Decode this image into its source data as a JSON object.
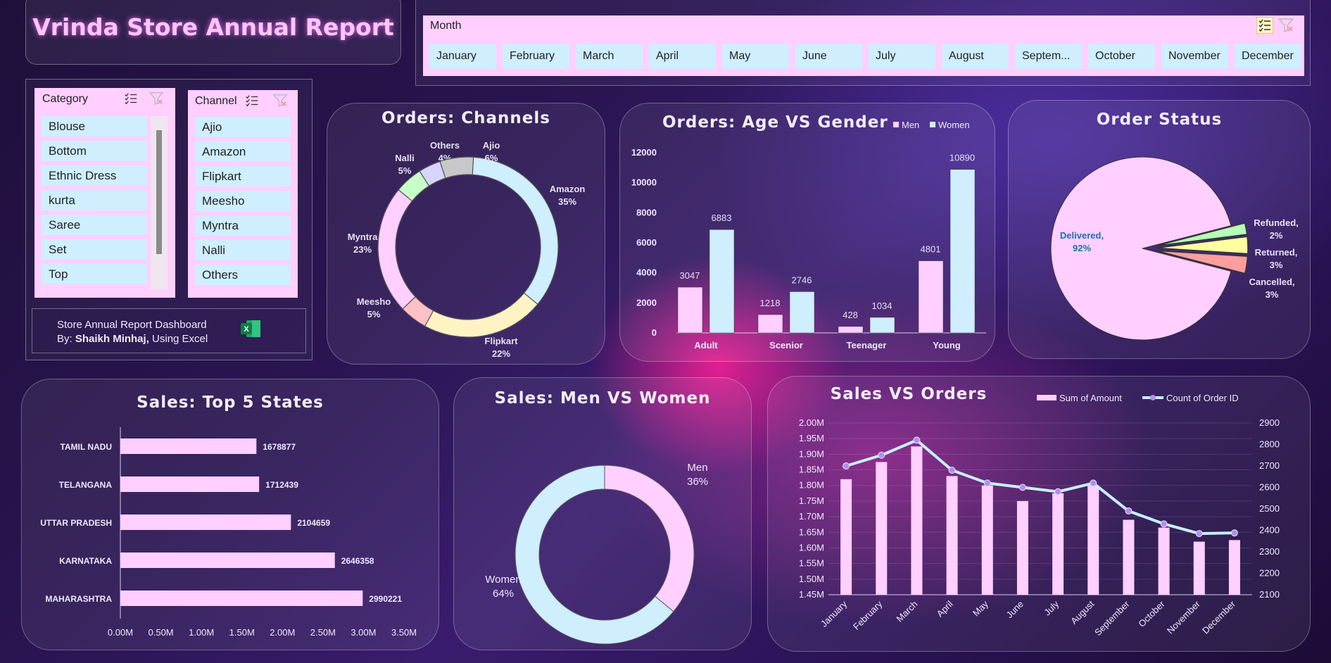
{
  "title": "Vrinda Store Annual Report",
  "month_slicer": {
    "label": "Month",
    "items": [
      "January",
      "February",
      "March",
      "April",
      "May",
      "June",
      "July",
      "August",
      "Septem...",
      "October",
      "November",
      "December"
    ]
  },
  "category_slicer": {
    "label": "Category",
    "items": [
      "Blouse",
      "Bottom",
      "Ethnic Dress",
      "kurta",
      "Saree",
      "Set",
      "Top"
    ]
  },
  "channel_slicer": {
    "label": "Channel",
    "items": [
      "Ajio",
      "Amazon",
      "Flipkart",
      "Meesho",
      "Myntra",
      "Nalli",
      "Others"
    ]
  },
  "credit": {
    "line1": "Store Annual Report Dashboard",
    "line2_prefix": "By: ",
    "line2_name": "Shaikh Minhaj,",
    "line2_suffix": " Using Excel",
    "icon": "excel-logo-icon"
  },
  "colors": {
    "pink": "#ffcfff",
    "blue": "#cfeefe",
    "yellow": "#fff3c4",
    "green": "#c8ffc8",
    "lavender": "#d8d4ff",
    "grey": "#c8c8c8",
    "peach": "#ffc0c8",
    "refunded": "#b6ffb6",
    "returned": "#ffff9e",
    "cancelled": "#ff9e9e",
    "line": "#c8f0ff",
    "marker": "#b48cf0"
  },
  "chart_data": [
    {
      "id": "channels",
      "type": "pie",
      "title": "Orders: Channels",
      "categories": [
        "Amazon",
        "Flipkart",
        "Meesho",
        "Myntra",
        "Nalli",
        "Others",
        "Ajio"
      ],
      "values": [
        35,
        22,
        5,
        23,
        5,
        4,
        6
      ],
      "labels": [
        "35%",
        "22%",
        "5%",
        "23%",
        "5%",
        "4%",
        "6%"
      ]
    },
    {
      "id": "age_gender",
      "type": "bar",
      "title": "Orders: Age VS Gender",
      "categories": [
        "Adult",
        "Scenior",
        "Teenager",
        "Young"
      ],
      "series": [
        {
          "name": "Men",
          "values": [
            3047,
            1218,
            428,
            4801
          ]
        },
        {
          "name": "Women",
          "values": [
            6883,
            2746,
            1034,
            10890
          ]
        }
      ],
      "ylim": [
        0,
        12000
      ],
      "yticks": [
        "0",
        "2000",
        "4000",
        "6000",
        "8000",
        "10000",
        "12000"
      ],
      "legend": "top-right"
    },
    {
      "id": "order_status",
      "type": "pie",
      "title": "Order Status",
      "categories": [
        "Delivered",
        "Refunded",
        "Returned",
        "Cancelled"
      ],
      "values": [
        92,
        2,
        3,
        3
      ],
      "labels": [
        "92%",
        "2%",
        "3%",
        "3%"
      ]
    },
    {
      "id": "top_states",
      "type": "bar",
      "title": "Sales: Top 5 States",
      "categories": [
        "TAMIL NADU",
        "TELANGANA",
        "UTTAR PRADESH",
        "KARNATAKA",
        "MAHARASHTRA"
      ],
      "values": [
        1678877,
        1712439,
        2104659,
        2646358,
        2990221
      ],
      "labels": [
        "1678877",
        "1712439",
        "2104659",
        "2646358",
        "2990221"
      ],
      "xlim": [
        0,
        3500000
      ],
      "xticks": [
        "0.00M",
        "0.50M",
        "1.00M",
        "1.50M",
        "2.00M",
        "2.50M",
        "3.00M",
        "3.50M"
      ]
    },
    {
      "id": "men_women",
      "type": "pie",
      "title": "Sales: Men VS Women",
      "categories": [
        "Men",
        "Women"
      ],
      "values": [
        36,
        64
      ],
      "labels": [
        "36%",
        "64%"
      ]
    },
    {
      "id": "sales_orders",
      "type": "bar",
      "title": "Sales VS Orders",
      "categories": [
        "January",
        "February",
        "March",
        "April",
        "May",
        "June",
        "July",
        "August",
        "September",
        "October",
        "November",
        "December"
      ],
      "series": [
        {
          "name": "Sum of Amount",
          "values": [
            1820000,
            1875000,
            1925000,
            1830000,
            1800000,
            1750000,
            1775000,
            1800000,
            1690000,
            1665000,
            1620000,
            1625000
          ]
        },
        {
          "name": "Count of Order ID",
          "values": [
            2700,
            2750,
            2820,
            2680,
            2620,
            2600,
            2580,
            2620,
            2490,
            2430,
            2385,
            2388
          ]
        }
      ],
      "ylim": [
        1450000,
        2000000
      ],
      "y2lim": [
        2100,
        2900
      ],
      "yticks": [
        "1.45M",
        "1.50M",
        "1.55M",
        "1.60M",
        "1.65M",
        "1.70M",
        "1.75M",
        "1.80M",
        "1.85M",
        "1.90M",
        "1.95M",
        "2.00M"
      ],
      "y2ticks": [
        "2100",
        "2200",
        "2300",
        "2400",
        "2500",
        "2600",
        "2700",
        "2800",
        "2900"
      ],
      "legend": "top-right"
    }
  ]
}
